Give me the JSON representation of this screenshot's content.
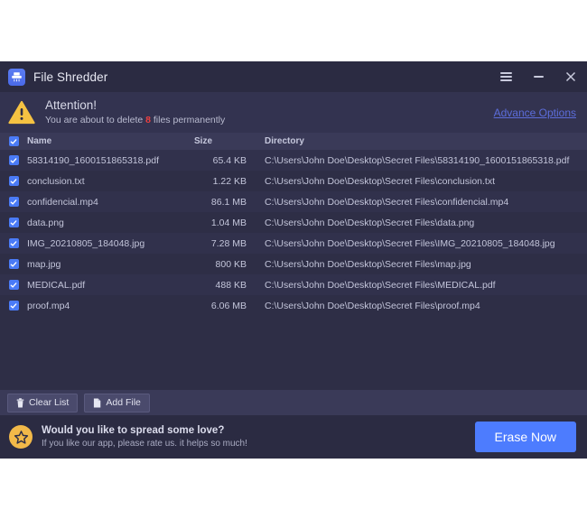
{
  "window": {
    "title": "File Shredder",
    "app_icon": "shredder-icon",
    "controls": {
      "menu": "hamburger-menu-icon",
      "minimize": "minimize-icon",
      "close": "close-icon"
    }
  },
  "attention": {
    "icon": "warning-triangle-icon",
    "title": "Attention!",
    "message_prefix": "You are about to delete ",
    "file_count": "8",
    "message_suffix": " files permanently",
    "advance_options_label": "Advance Options",
    "link_color": "#5c6ddb",
    "count_color": "#ed3f3f"
  },
  "table": {
    "select_all_checked": true,
    "columns": {
      "name": "Name",
      "size": "Size",
      "directory": "Directory"
    },
    "rows": [
      {
        "checked": true,
        "name": "58314190_1600151865318.pdf",
        "size": "65.4 KB",
        "directory": "C:\\Users\\John Doe\\Desktop\\Secret Files\\58314190_1600151865318.pdf"
      },
      {
        "checked": true,
        "name": "conclusion.txt",
        "size": "1.22 KB",
        "directory": "C:\\Users\\John Doe\\Desktop\\Secret Files\\conclusion.txt"
      },
      {
        "checked": true,
        "name": "confidencial.mp4",
        "size": "86.1 MB",
        "directory": "C:\\Users\\John Doe\\Desktop\\Secret Files\\confidencial.mp4"
      },
      {
        "checked": true,
        "name": "data.png",
        "size": "1.04 MB",
        "directory": "C:\\Users\\John Doe\\Desktop\\Secret Files\\data.png"
      },
      {
        "checked": true,
        "name": "IMG_20210805_184048.jpg",
        "size": "7.28 MB",
        "directory": "C:\\Users\\John Doe\\Desktop\\Secret Files\\IMG_20210805_184048.jpg"
      },
      {
        "checked": true,
        "name": "map.jpg",
        "size": "800 KB",
        "directory": "C:\\Users\\John Doe\\Desktop\\Secret Files\\map.jpg"
      },
      {
        "checked": true,
        "name": "MEDICAL.pdf",
        "size": "488 KB",
        "directory": "C:\\Users\\John Doe\\Desktop\\Secret Files\\MEDICAL.pdf"
      },
      {
        "checked": true,
        "name": "proof.mp4",
        "size": "6.06 MB",
        "directory": "C:\\Users\\John Doe\\Desktop\\Secret Files\\proof.mp4"
      }
    ]
  },
  "actions": {
    "clear_list_label": "Clear List",
    "clear_list_icon": "trash-icon",
    "add_file_label": "Add File",
    "add_file_icon": "document-icon"
  },
  "footer": {
    "star_icon": "star-icon",
    "title": "Would you like to spread some love?",
    "subtitle": "If you like our app, please rate us. it helps so much!",
    "erase_label": "Erase Now",
    "erase_color": "#4d7cfe"
  }
}
